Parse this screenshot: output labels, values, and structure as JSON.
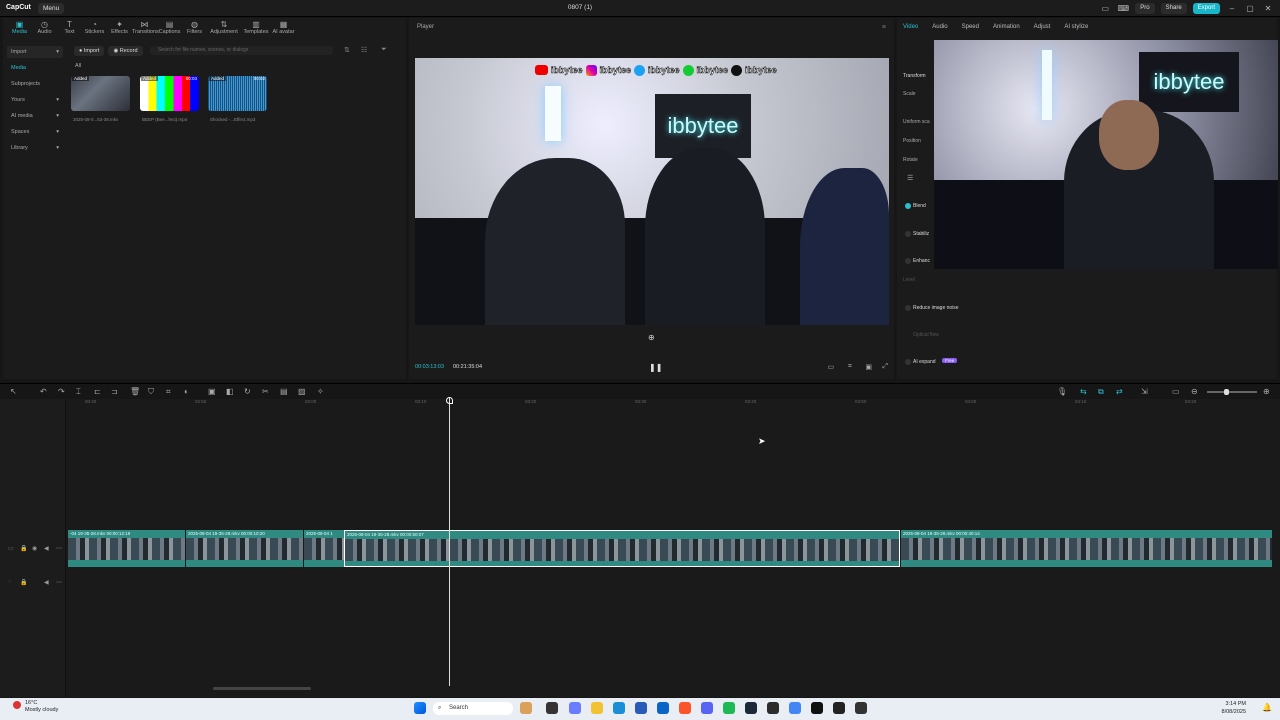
{
  "app": {
    "logo": "CapCut",
    "menu": "Menu",
    "title": "0807 (1)"
  },
  "topbar": {
    "pro": "Pro",
    "share": "Share",
    "export": "Export"
  },
  "tools": [
    {
      "label": "Media",
      "icon": "media-icon"
    },
    {
      "label": "Audio",
      "icon": "audio-icon"
    },
    {
      "label": "Text",
      "icon": "text-icon"
    },
    {
      "label": "Stickers",
      "icon": "stickers-icon"
    },
    {
      "label": "Effects",
      "icon": "effects-icon"
    },
    {
      "label": "Transitions",
      "icon": "transitions-icon"
    },
    {
      "label": "Captions",
      "icon": "captions-icon"
    },
    {
      "label": "Filters",
      "icon": "filters-icon"
    },
    {
      "label": "Adjustment",
      "icon": "adjustment-icon"
    },
    {
      "label": "Templates",
      "icon": "templates-icon"
    },
    {
      "label": "AI avatar",
      "icon": "ai-avatar-icon"
    }
  ],
  "sidebar": {
    "items": [
      "Import",
      "Media",
      "Subprojects",
      "Yours",
      "AI media",
      "Spaces",
      "Library"
    ]
  },
  "media": {
    "import": "Import",
    "record": "Record",
    "search_placeholder": "Search for file names, scenes, or dialogs",
    "all": "All",
    "items": [
      {
        "tag": "Added",
        "duration": "",
        "name": "2025-08-0...53-38.mkv"
      },
      {
        "tag": "Added",
        "duration": "00:03",
        "name": "BEEP (Bee...fect).mp4"
      },
      {
        "tag": "Added",
        "duration": "00:02",
        "name": "Shocked -...Effect.mp3"
      }
    ]
  },
  "player": {
    "title": "Player",
    "overlay_handle": "ibbytee",
    "sign": "ibbytee",
    "current_time": "00:03:13:03",
    "total_time": "00:21:35:04"
  },
  "right": {
    "tabs": [
      "Video",
      "Audio",
      "Speed",
      "Animation",
      "Adjust",
      "AI stylize"
    ],
    "props": {
      "transform": "Transform",
      "scale": "Scale",
      "uniform": "Uniform sca",
      "position": "Position",
      "rotate": "Rotate",
      "blend": "Blend",
      "stabilize": "Stabiliz",
      "enhance": "Enhanc",
      "level": "Level",
      "reduce_noise": "Reduce image noise",
      "optical_flow": "Optical flow",
      "ai_expand": "AI expand",
      "ai_expand_badge": "Free"
    },
    "camera_sign": "ibbytee"
  },
  "timeline": {
    "ruler": [
      "00:40",
      "02:50",
      "03:00",
      "03:10",
      "03:20",
      "03:30",
      "03:40",
      "03:50",
      "04:00",
      "04:10",
      "04:20"
    ],
    "clips": [
      {
        "label": "-04 19-35-28.mkv   00:00:12:19"
      },
      {
        "label": "2025-08-04 19-35-28.mkv   00:00:10:20"
      },
      {
        "label": "2025-08-04 1"
      },
      {
        "label": "2025-08-04 19-35-28.mkv   00:00:50:07"
      },
      {
        "label": "2025-08-04 19-35-28.mkv   00:00:40:14"
      }
    ]
  },
  "taskbar": {
    "weather_temp": "16°C",
    "weather_desc": "Mostly cloudy",
    "search": "Search",
    "time": "3:14 PM",
    "date": "8/08/2025"
  },
  "colors": {
    "accent": "#2bc0d0",
    "clip": "#2f8a82",
    "export": "#17b7c9"
  }
}
